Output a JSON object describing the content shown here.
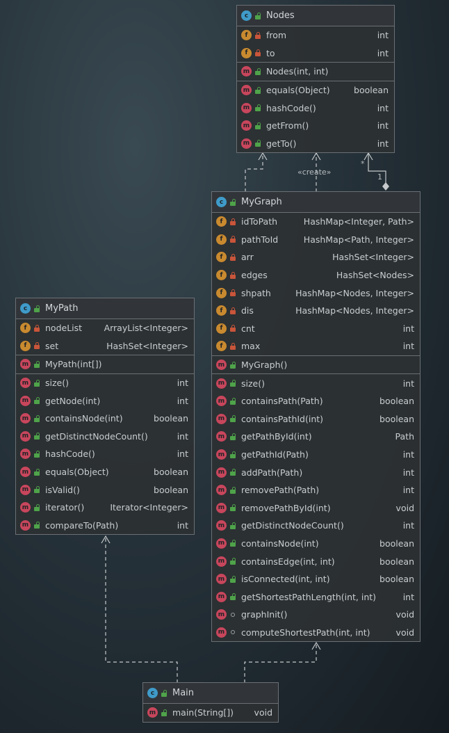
{
  "classes": {
    "nodes": {
      "name": "Nodes",
      "fields": [
        {
          "name": "from",
          "type": "int"
        },
        {
          "name": "to",
          "type": "int"
        }
      ],
      "constructor": {
        "name": "Nodes(int, int)",
        "type": ""
      },
      "methods": [
        {
          "name": "equals(Object)",
          "type": "boolean"
        },
        {
          "name": "hashCode()",
          "type": "int"
        },
        {
          "name": "getFrom()",
          "type": "int"
        },
        {
          "name": "getTo()",
          "type": "int"
        }
      ]
    },
    "mygraph": {
      "name": "MyGraph",
      "fields": [
        {
          "name": "idToPath",
          "type": "HashMap<Integer, Path>"
        },
        {
          "name": "pathToId",
          "type": "HashMap<Path, Integer>"
        },
        {
          "name": "arr",
          "type": "HashSet<Integer>"
        },
        {
          "name": "edges",
          "type": "HashSet<Nodes>"
        },
        {
          "name": "shpath",
          "type": "HashMap<Nodes, Integer>"
        },
        {
          "name": "dis",
          "type": "HashMap<Nodes, Integer>"
        },
        {
          "name": "cnt",
          "type": "int"
        },
        {
          "name": "max",
          "type": "int"
        }
      ],
      "constructor": {
        "name": "MyGraph()",
        "type": ""
      },
      "methods": [
        {
          "name": "size()",
          "type": "int"
        },
        {
          "name": "containsPath(Path)",
          "type": "boolean"
        },
        {
          "name": "containsPathId(int)",
          "type": "boolean"
        },
        {
          "name": "getPathById(int)",
          "type": "Path"
        },
        {
          "name": "getPathId(Path)",
          "type": "int"
        },
        {
          "name": "addPath(Path)",
          "type": "int"
        },
        {
          "name": "removePath(Path)",
          "type": "int"
        },
        {
          "name": "removePathById(int)",
          "type": "void"
        },
        {
          "name": "getDistinctNodeCount()",
          "type": "int"
        },
        {
          "name": "containsNode(int)",
          "type": "boolean"
        },
        {
          "name": "containsEdge(int, int)",
          "type": "boolean"
        },
        {
          "name": "isConnected(int, int)",
          "type": "boolean"
        },
        {
          "name": "getShortestPathLength(int, int)",
          "type": "int"
        },
        {
          "name": "graphInit()",
          "type": "void"
        },
        {
          "name": "computeShortestPath(int, int)",
          "type": "void"
        }
      ]
    },
    "mypath": {
      "name": "MyPath",
      "fields": [
        {
          "name": "nodeList",
          "type": "ArrayList<Integer>"
        },
        {
          "name": "set",
          "type": "HashSet<Integer>"
        }
      ],
      "constructor": {
        "name": "MyPath(int[])",
        "type": ""
      },
      "methods": [
        {
          "name": "size()",
          "type": "int"
        },
        {
          "name": "getNode(int)",
          "type": "int"
        },
        {
          "name": "containsNode(int)",
          "type": "boolean"
        },
        {
          "name": "getDistinctNodeCount()",
          "type": "int"
        },
        {
          "name": "hashCode()",
          "type": "int"
        },
        {
          "name": "equals(Object)",
          "type": "boolean"
        },
        {
          "name": "isValid()",
          "type": "boolean"
        },
        {
          "name": "iterator()",
          "type": "Iterator<Integer>"
        },
        {
          "name": "compareTo(Path)",
          "type": "int"
        }
      ]
    },
    "main": {
      "name": "Main",
      "methods": [
        {
          "name": "main(String[])",
          "type": "void"
        }
      ]
    }
  },
  "labels": {
    "create": "«create»",
    "multiplicity_many": "*",
    "multiplicity_one": "1"
  }
}
